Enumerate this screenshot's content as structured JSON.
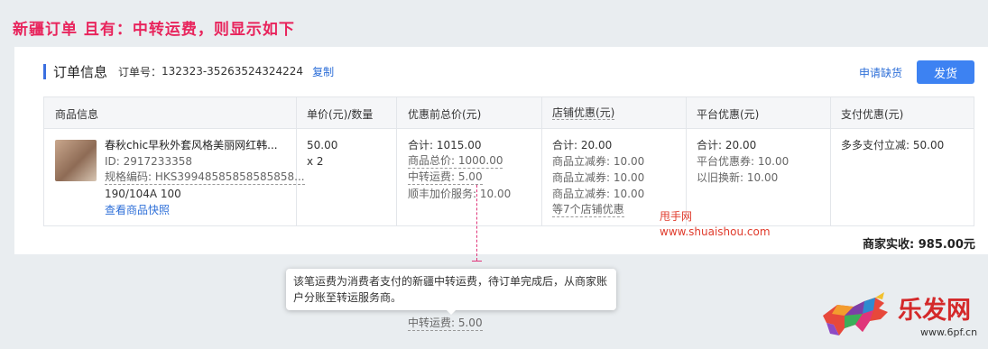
{
  "headline": "新疆订单 且有：中转运费，则显示如下",
  "order": {
    "title": "订单信息",
    "no_label": "订单号：",
    "no": "132323-35263524324224",
    "copy": "复制",
    "apply": "申请缺货",
    "ship": "发货"
  },
  "table": {
    "headers": [
      "商品信息",
      "单价(元)/数量",
      "优惠前总价(元)",
      "店铺优惠(元)",
      "平台优惠(元)",
      "支付优惠(元)"
    ],
    "product": {
      "name": "春秋chic早秋外套风格美丽网红韩...",
      "id": "ID: 2917233358",
      "sku": "规格编码: HKS39948585858585858...",
      "spec": "190/104A 100",
      "snapshot": "查看商品快照"
    },
    "price": {
      "unit": "50.00",
      "qty": "x 2"
    },
    "before": {
      "total": "合计: 1015.00",
      "goods": "商品总价: 1000.00",
      "freight": "中转运费: 5.00",
      "sf": "顺丰加价服务: 10.00"
    },
    "shop": {
      "total": "合计: 20.00",
      "c1": "商品立减券: 10.00",
      "c2": "商品立减券: 10.00",
      "c3": "商品立减券: 10.00",
      "more": "等7个店铺优惠"
    },
    "platform": {
      "total": "合计: 20.00",
      "coupon": "平台优惠券: 10.00",
      "trade": "以旧换新: 10.00"
    },
    "pay": {
      "multi": "多多支付立减: 50.00"
    }
  },
  "settle": "商家实收: 985.00元",
  "watermark": {
    "name": "甩手网",
    "url": "www.shuaishou.com"
  },
  "tooltip": "该笔运费为消费者支付的新疆中转运费，待订单完成后，从商家账户分账至转运服务商。",
  "freight_repeat": "中转运费: 5.00",
  "logo": {
    "text": "乐发网",
    "url": "www.6pf.cn"
  },
  "colors": {
    "accent": "#3d82f2",
    "headline": "#e8245c",
    "watermark": "#e03b2c"
  }
}
